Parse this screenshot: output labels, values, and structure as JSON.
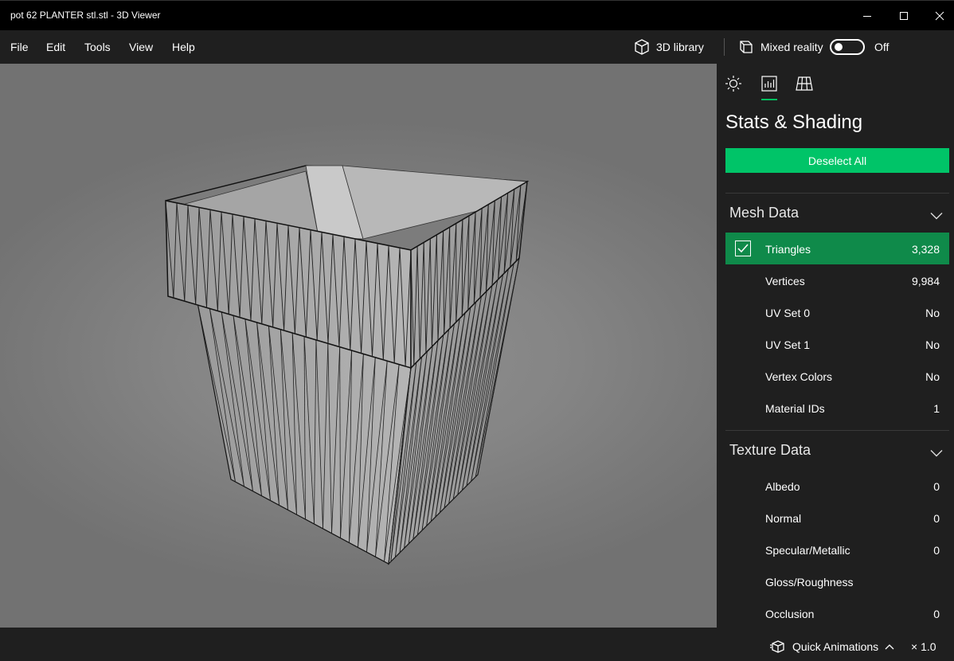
{
  "window": {
    "title": "pot 62 PLANTER stl.stl - 3D Viewer",
    "controls": [
      "minimize-icon",
      "maximize-icon",
      "close-icon"
    ]
  },
  "menu": {
    "items": [
      "File",
      "Edit",
      "Tools",
      "View",
      "Help"
    ],
    "library_label": "3D library",
    "mixed_reality_label": "Mixed reality",
    "mixed_reality_state": "Off"
  },
  "panel": {
    "tabs": [
      "sun-icon",
      "stats-icon",
      "grid-icon"
    ],
    "active_tab": 1,
    "title": "Stats & Shading",
    "deselect_label": "Deselect All",
    "mesh": {
      "heading": "Mesh Data",
      "rows": [
        {
          "label": "Triangles",
          "value": "3,328",
          "selected": true
        },
        {
          "label": "Vertices",
          "value": "9,984"
        },
        {
          "label": "UV Set 0",
          "value": "No"
        },
        {
          "label": "UV Set 1",
          "value": "No"
        },
        {
          "label": "Vertex Colors",
          "value": "No"
        },
        {
          "label": "Material IDs",
          "value": "1"
        }
      ]
    },
    "texture": {
      "heading": "Texture Data",
      "rows": [
        {
          "label": "Albedo",
          "value": "0"
        },
        {
          "label": "Normal",
          "value": "0"
        },
        {
          "label": "Specular/Metallic",
          "value": "0"
        },
        {
          "label": "Gloss/Roughness",
          "value": ""
        },
        {
          "label": "Occlusion",
          "value": "0"
        }
      ]
    }
  },
  "status": {
    "animations_label": "Quick Animations",
    "speed": "× 1.0"
  },
  "colors": {
    "accent": "#00c468",
    "selected_row": "#0f8a4a",
    "chrome": "#1f1f1f"
  }
}
